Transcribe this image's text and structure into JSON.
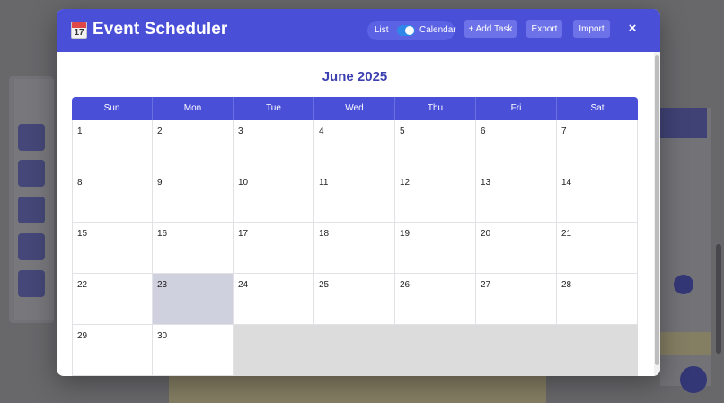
{
  "header": {
    "title": "Event Scheduler",
    "icon": "calendar-emoji-icon",
    "icon_date": "17",
    "toggle": {
      "left_label": "List",
      "right_label": "Calendar",
      "state": "Calendar"
    },
    "buttons": {
      "add_task": "+ Add Task",
      "export": "Export",
      "import": "Import"
    },
    "close": "×"
  },
  "calendar": {
    "month_label": "June 2025",
    "weekdays": [
      "Sun",
      "Mon",
      "Tue",
      "Wed",
      "Thu",
      "Fri",
      "Sat"
    ],
    "weeks": [
      [
        "1",
        "2",
        "3",
        "4",
        "5",
        "6",
        "7"
      ],
      [
        "8",
        "9",
        "10",
        "11",
        "12",
        "13",
        "14"
      ],
      [
        "15",
        "16",
        "17",
        "18",
        "19",
        "20",
        "21"
      ],
      [
        "22",
        "23",
        "24",
        "25",
        "26",
        "27",
        "28"
      ],
      [
        "29",
        "30",
        "",
        "",
        "",
        "",
        ""
      ]
    ],
    "highlighted_day": "23"
  },
  "colors": {
    "primary": "#4a4fd8",
    "title_text": "#3c3fb0",
    "highlight": "#d0d1de",
    "empty_cell": "#dcdcdc"
  }
}
